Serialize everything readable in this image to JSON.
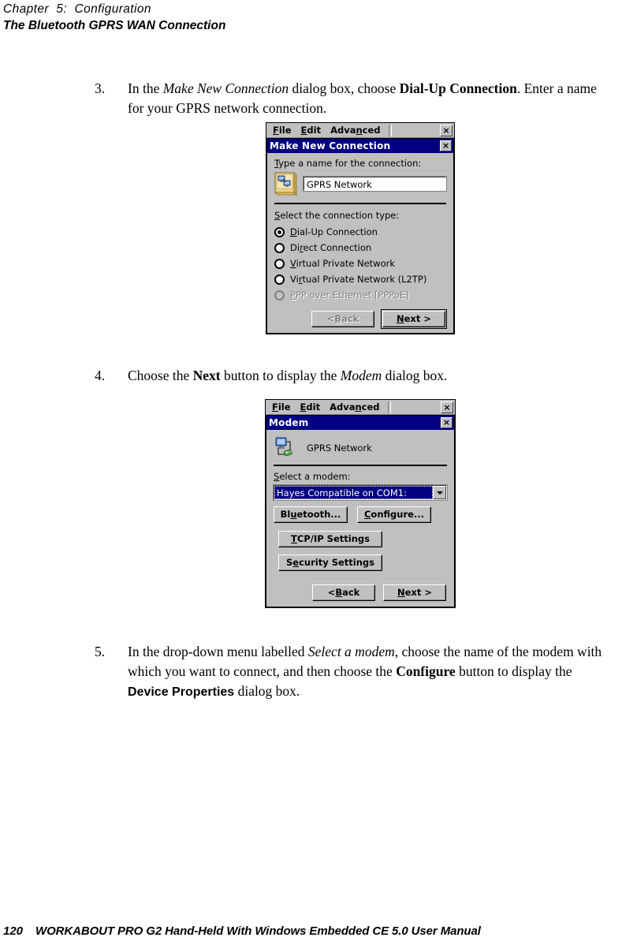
{
  "page": {
    "running_head_chapter": "Chapter  5:  Configuration",
    "running_head_title": "The Bluetooth GPRS WAN Connection",
    "footer_page_number": "120",
    "footer_text": "WORKABOUT PRO G2 Hand-Held With Windows Embedded CE 5.0 User Manual"
  },
  "steps": [
    {
      "number": "3.",
      "line1_pre": "In the ",
      "line1_italic": "Make New Connection",
      "line1_mid": " dialog box, choose ",
      "line1_bold": "Dial-Up Connection",
      "line1_post": ".",
      "line2": "Enter a name for your GPRS network connection."
    },
    {
      "number": "4.",
      "pre": "Choose the ",
      "bold1": "Next",
      "mid": " button to display the ",
      "italic1": "Modem",
      "post": " dialog box."
    },
    {
      "number": "5.",
      "pre": "In the drop-down menu labelled ",
      "italic1": "Select a modem",
      "mid": ", choose the name of the modem with which you want to connect, and then choose the ",
      "bold1": "Configure",
      "mid2": " button to display the ",
      "bold2": "Device Properties",
      "post": " dialog box."
    }
  ],
  "dialog_make_new_connection": {
    "menubar": {
      "items": [
        {
          "pre": "",
          "acc": "F",
          "post": "ile"
        },
        {
          "pre": "",
          "acc": "E",
          "post": "dit"
        },
        {
          "pre": "Adva",
          "acc": "n",
          "post": "ced"
        }
      ],
      "close_label": "×"
    },
    "title": "Make New Connection",
    "title_close_label": "×",
    "name_label_acc": "T",
    "name_label_rest": "ype a name for the connection:",
    "connection_name_value": "GPRS Network",
    "type_label_acc": "S",
    "type_label_rest": "elect the connection type:",
    "connection_types": [
      {
        "pre": "",
        "acc": "D",
        "post": "ial-Up Connection",
        "selected": true,
        "disabled": false
      },
      {
        "pre": "Di",
        "acc": "r",
        "post": "ect Connection",
        "selected": false,
        "disabled": false
      },
      {
        "pre": "",
        "acc": "V",
        "post": "irtual Private Network",
        "selected": false,
        "disabled": false
      },
      {
        "pre": "Vi",
        "acc": "r",
        "post": "tual Private Network (L2TP)",
        "selected": false,
        "disabled": false
      },
      {
        "pre": "",
        "acc": "P",
        "post": "PP over Ethernet [PPPoE]",
        "selected": false,
        "disabled": true
      }
    ],
    "back_button": {
      "pre": "< ",
      "acc": "B",
      "post": "ack",
      "disabled": true,
      "default": false
    },
    "next_button": {
      "pre": "",
      "acc": "N",
      "post": "ext >",
      "disabled": false,
      "default": true
    }
  },
  "dialog_modem": {
    "menubar": {
      "items": [
        {
          "pre": "",
          "acc": "F",
          "post": "ile"
        },
        {
          "pre": "",
          "acc": "E",
          "post": "dit"
        },
        {
          "pre": "Adva",
          "acc": "n",
          "post": "ced"
        }
      ],
      "close_label": "×"
    },
    "title": "Modem",
    "title_close_label": "×",
    "connection_name": "GPRS Network",
    "modem_label_acc": "S",
    "modem_label_rest": "elect a modem:",
    "selected_modem": "Hayes Compatible on COM1:",
    "bluetooth_button": {
      "pre": "Bl",
      "acc": "u",
      "post": "etooth..."
    },
    "configure_button": {
      "pre": "",
      "acc": "C",
      "post": "onfigure..."
    },
    "tcpip_button": {
      "pre": "",
      "acc": "T",
      "post": "CP/IP Settings"
    },
    "security_button": {
      "pre": "S",
      "acc": "e",
      "post": "curity Settings"
    },
    "back_button": {
      "pre": "< ",
      "acc": "B",
      "post": "ack",
      "disabled": false,
      "default": false
    },
    "next_button": {
      "pre": "",
      "acc": "N",
      "post": "ext >",
      "disabled": false,
      "default": false
    }
  },
  "colors": {
    "titlebar": "#000080",
    "dialog_face": "#c0c0c0",
    "selection": "#000080",
    "disabled_text": "#808080"
  }
}
